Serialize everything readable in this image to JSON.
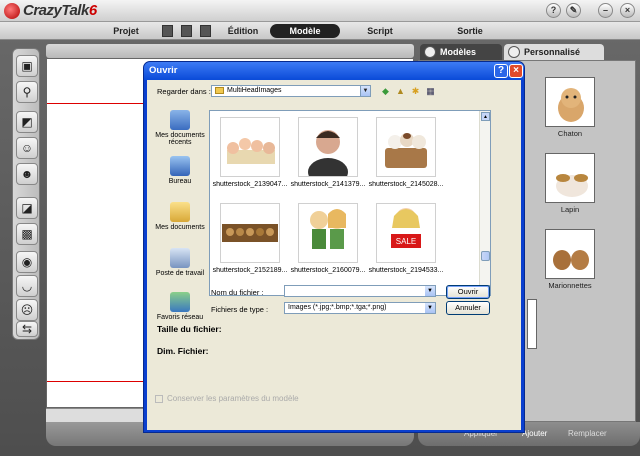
{
  "app": {
    "title": "CrazyTalk",
    "version": "6"
  },
  "menu": {
    "projet": "Projet",
    "edition": "Édition",
    "modele": "Modèle",
    "script": "Script",
    "sortie": "Sortie"
  },
  "panel": {
    "tab_modeles": "Modèles",
    "tab_personnalise": "Personnalisé",
    "items": [
      {
        "label": "Chaton"
      },
      {
        "label": "Lapin"
      },
      {
        "label": "Marionnettes"
      }
    ],
    "appliquer": "Appliquer",
    "ajouter": "Ajouter",
    "remplacer": "Remplacer"
  },
  "dialog": {
    "title": "Ouvrir",
    "look_in_label": "Regarder dans :",
    "look_in_value": "MultiHeadImages",
    "places": [
      {
        "label": "Mes documents récents",
        "icon": "recent-documents-icon"
      },
      {
        "label": "Bureau",
        "icon": "desktop-icon"
      },
      {
        "label": "Mes documents",
        "icon": "my-documents-icon"
      },
      {
        "label": "Poste de travail",
        "icon": "my-computer-icon"
      },
      {
        "label": "Favoris réseau",
        "icon": "network-places-icon"
      }
    ],
    "files": [
      {
        "name": "shutterstock_2139047..."
      },
      {
        "name": "shutterstock_2141379..."
      },
      {
        "name": "shutterstock_2145028..."
      },
      {
        "name": "shutterstock_2152189..."
      },
      {
        "name": "shutterstock_2160079..."
      },
      {
        "name": "shutterstock_2194533..."
      }
    ],
    "sale_text": "SALE",
    "filename_label": "Nom du fichier :",
    "filename_value": "",
    "filetype_label": "Fichiers de type :",
    "filetype_value": "Images (*.jpg;*.bmp;*.tga;*.png)",
    "open_button": "Ouvrir",
    "cancel_button": "Annuler",
    "file_size_label": "Taille du fichier:",
    "dimensions_label": "Dim. Fichier:",
    "keep_params_label": "Conserver les paramètres du modèle"
  },
  "colors": {
    "xp_blue": "#0a4ad8",
    "dialog_body": "#ece9d8",
    "accent_red": "#cc0000"
  }
}
